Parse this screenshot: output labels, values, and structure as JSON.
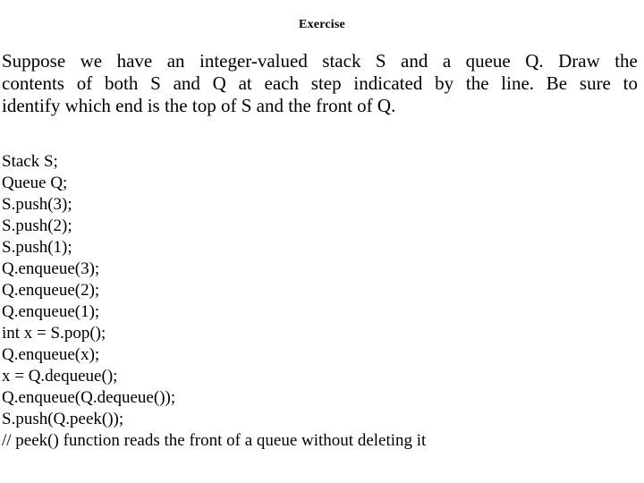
{
  "slide": {
    "title": "Exercise",
    "intro": {
      "full_text": "Suppose we have an integer-valued stack S and a queue Q. Draw the contents of both S and Q at each step indicated by the line. Be sure to identify which end is the top of S and the front of Q.",
      "lines": [
        {
          "words": [
            "Suppose",
            "we",
            "have",
            "an",
            "integer-valued",
            "stack",
            "S",
            "and",
            "a",
            "queue",
            "Q.",
            "Draw",
            "the"
          ]
        },
        {
          "words": [
            "contents",
            "of",
            "both",
            "S",
            "and",
            "Q",
            "at",
            "each",
            "step",
            "indicated",
            "by",
            "the",
            "line.",
            "Be",
            "sure",
            "to"
          ]
        },
        {
          "text": "identify which end is the top of S and the front of Q."
        }
      ]
    },
    "code": {
      "lines": [
        "Stack S;",
        "Queue Q;",
        "S.push(3);",
        "S.push(2);",
        "S.push(1);",
        "Q.enqueue(3);",
        "Q.enqueue(2);",
        "Q.enqueue(1);",
        "int x = S.pop();",
        "Q.enqueue(x);",
        "x = Q.dequeue();",
        "Q.enqueue(Q.dequeue());",
        "S.push(Q.peek());"
      ],
      "comment": "// peek() function reads the front of a queue without deleting it"
    }
  },
  "colors": {
    "background": "#ffffff",
    "text": "#000000"
  }
}
